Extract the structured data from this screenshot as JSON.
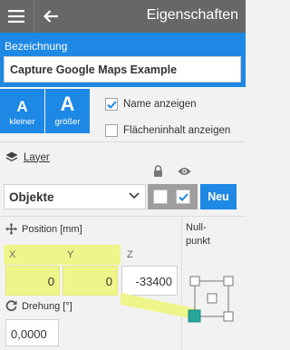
{
  "header": {
    "title": "Eigenschaften",
    "menu_icon": "hamburger-menu-icon",
    "back_icon": "arrow-left-icon",
    "bg_color": "#676767"
  },
  "name_section": {
    "label": "Bezeichnung",
    "value": "Capture Google Maps Example",
    "bg_color": "#1e88e5"
  },
  "text_size": {
    "smaller": {
      "glyph": "A",
      "label": "kleiner"
    },
    "larger": {
      "glyph": "A",
      "label": "größer"
    }
  },
  "options": {
    "show_name": {
      "label": "Name anzeigen",
      "checked": true
    },
    "show_area": {
      "label": "Flächeninhalt anzeigen",
      "checked": false
    }
  },
  "layer": {
    "label": "Layer",
    "icon": "layers-icon",
    "selected": "Objekte",
    "lock_icon": "lock-icon",
    "eye_icon": "eye-icon",
    "locked": false,
    "visible": true,
    "new_label": "Neu"
  },
  "position": {
    "label": "Position [mm]",
    "icon": "move-arrows-icon",
    "x_label": "X",
    "y_label": "Y",
    "z_label": "Z",
    "x_value": "0",
    "y_value": "0",
    "z_value": "-33400",
    "highlight_color": "#eef58a"
  },
  "rotation": {
    "label": "Drehung [°]",
    "icon": "rotate-icon",
    "value": "0,0000"
  },
  "origin": {
    "label_line1": "Null-",
    "label_line2": "punkt",
    "selected_anchor": "bottom-left",
    "selected_color": "#26a69a"
  }
}
